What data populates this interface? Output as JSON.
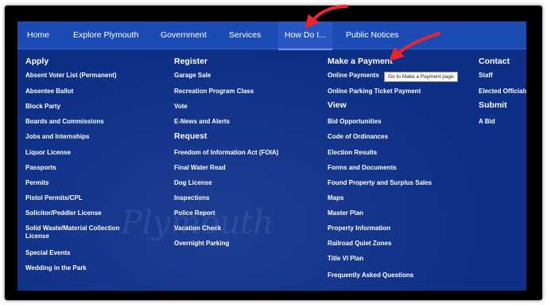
{
  "nav": {
    "items": [
      "Home",
      "Explore Plymouth",
      "Government",
      "Services",
      "How Do I...",
      "Public Notices"
    ]
  },
  "watermark": "Plymouth",
  "columns": {
    "apply": {
      "heading": "Apply",
      "links": [
        "Absent Voter List (Permanent)",
        "Absentee Ballot",
        "Block Party",
        "Boards and Commissions",
        "Jobs and Internships",
        "Liquor License",
        "Passports",
        "Permits",
        "Pistol Permits/CPL",
        "Solicitor/Peddler License",
        "Solid Waste/Material Collection License",
        "Special Events",
        "Wedding in the Park"
      ]
    },
    "register": {
      "heading": "Register",
      "links": [
        "Garage Sale",
        "Recreation Program Class",
        "Vote",
        "E-News and Alerts"
      ]
    },
    "request": {
      "heading": "Request",
      "links": [
        "Freedom of Information Act (FOIA)",
        "Final Water Read",
        "Dog License",
        "Inspections",
        "Police Report",
        "Vacation Check",
        "Overnight Parking"
      ]
    },
    "payment": {
      "heading": "Make a Payment",
      "links": [
        "Online Payments",
        "Online Parking Ticket Payment"
      ]
    },
    "view": {
      "heading": "View",
      "links": [
        "Bid Opportunities",
        "Code of Ordinances",
        "Election Results",
        "Forms and Documents",
        "Found Property and Surplus Sales",
        "Maps",
        "Master Plan",
        "Property Information",
        "Railroad Quiet Zones",
        "Title VI Plan",
        "Frequently Asked Questions"
      ]
    },
    "contact": {
      "heading": "Contact",
      "links": [
        "Staff",
        "Elected Officials"
      ]
    },
    "submit": {
      "heading": "Submit",
      "links": [
        "A Bid"
      ]
    }
  },
  "tooltip": "Go to Make a Payment page",
  "colors": {
    "background": "#0d2f86",
    "nav_bar": "#1b4bb3",
    "arrow": "#e8262c"
  }
}
